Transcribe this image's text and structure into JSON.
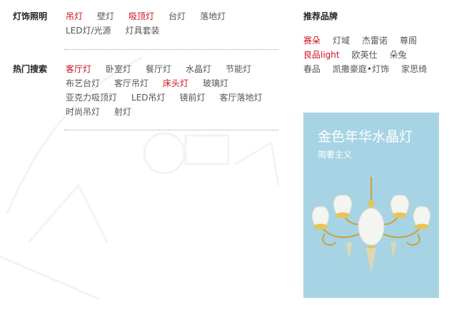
{
  "lighting": {
    "title": "灯饰照明",
    "links": [
      {
        "label": "吊灯",
        "hot": true
      },
      {
        "label": "壁灯",
        "hot": false
      },
      {
        "label": "吸顶灯",
        "hot": true
      },
      {
        "label": "台灯",
        "hot": false
      },
      {
        "label": "落地灯",
        "hot": false
      },
      {
        "label": "LED灯/光源",
        "hot": false
      },
      {
        "label": "灯具套装",
        "hot": false
      }
    ]
  },
  "hot_search": {
    "title": "热门搜索",
    "links": [
      {
        "label": "客厅灯",
        "hot": true
      },
      {
        "label": "卧室灯",
        "hot": false
      },
      {
        "label": "餐厅灯",
        "hot": false
      },
      {
        "label": "水晶灯",
        "hot": false
      },
      {
        "label": "节能灯",
        "hot": false
      },
      {
        "label": "布艺台灯",
        "hot": false
      },
      {
        "label": "客厅吊灯",
        "hot": false
      },
      {
        "label": "床头灯",
        "hot": true
      },
      {
        "label": "玻璃灯",
        "hot": false
      },
      {
        "label": "亚克力吸顶灯",
        "hot": false
      },
      {
        "label": "LED吊灯",
        "hot": false
      },
      {
        "label": "镜前灯",
        "hot": false
      },
      {
        "label": "客厅落地灯",
        "hot": false
      },
      {
        "label": "时尚吊灯",
        "hot": false
      },
      {
        "label": "射灯",
        "hot": false
      }
    ]
  },
  "brands": {
    "title": "推荐品牌",
    "items": [
      {
        "label": "赛朵",
        "hot": true
      },
      {
        "label": "灯域",
        "hot": false
      },
      {
        "label": "杰雷诺",
        "hot": false
      },
      {
        "label": "尊阁",
        "hot": false
      },
      {
        "label": "良品light",
        "hot": true
      },
      {
        "label": "欧英仕",
        "hot": false
      },
      {
        "label": "朵兔",
        "hot": false
      },
      {
        "label": "春品",
        "hot": false
      },
      {
        "label": "凯撒豪庭•灯饰",
        "hot": false
      },
      {
        "label": "家思绮",
        "hot": false
      }
    ]
  },
  "promo": {
    "title": "金色年华水晶灯",
    "subtitle": "简奢主义",
    "background": "#a6d4e4"
  },
  "colors": {
    "hot": "#c8111c",
    "normal": "#555555",
    "title": "#222222"
  }
}
